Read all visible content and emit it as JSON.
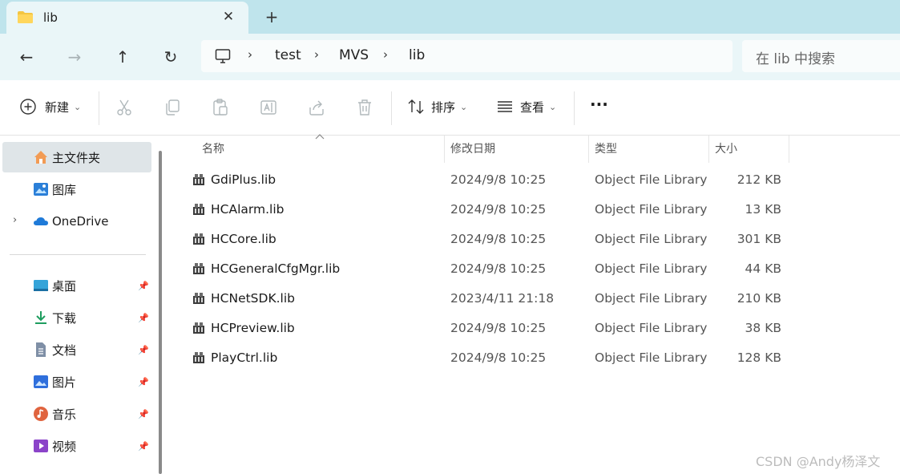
{
  "window": {
    "tab_title": "lib",
    "tab_close": "✕",
    "new_tab": "+"
  },
  "nav": {
    "back": "←",
    "forward": "→",
    "up": "↑",
    "refresh": "↻"
  },
  "breadcrumb": {
    "items": [
      "test",
      "MVS",
      "lib"
    ],
    "separator": "›"
  },
  "search": {
    "placeholder": "在 lib 中搜索"
  },
  "toolbar": {
    "new_label": "新建",
    "sort_label": "排序",
    "view_label": "查看",
    "more_label": "···",
    "dropdown_caret": "⌄"
  },
  "sidebar": {
    "items": [
      {
        "label": "主文件夹",
        "icon": "home-icon"
      },
      {
        "label": "图库",
        "icon": "gallery-icon"
      },
      {
        "label": "OneDrive",
        "icon": "cloud-icon",
        "expandable": true
      },
      {
        "label": "桌面",
        "icon": "desktop-icon",
        "pinned": true
      },
      {
        "label": "下载",
        "icon": "download-icon",
        "pinned": true
      },
      {
        "label": "文档",
        "icon": "document-icon",
        "pinned": true
      },
      {
        "label": "图片",
        "icon": "pictures-icon",
        "pinned": true
      },
      {
        "label": "音乐",
        "icon": "music-icon",
        "pinned": true
      },
      {
        "label": "视频",
        "icon": "video-icon",
        "pinned": true
      }
    ],
    "pin_glyph": "📌",
    "expand_glyph": "›"
  },
  "columns": {
    "name": "名称",
    "modified": "修改日期",
    "type": "类型",
    "size": "大小"
  },
  "files": [
    {
      "name": "GdiPlus.lib",
      "modified": "2024/9/8 10:25",
      "type": "Object File Library",
      "size": "212 KB"
    },
    {
      "name": "HCAlarm.lib",
      "modified": "2024/9/8 10:25",
      "type": "Object File Library",
      "size": "13 KB"
    },
    {
      "name": "HCCore.lib",
      "modified": "2024/9/8 10:25",
      "type": "Object File Library",
      "size": "301 KB"
    },
    {
      "name": "HCGeneralCfgMgr.lib",
      "modified": "2024/9/8 10:25",
      "type": "Object File Library",
      "size": "44 KB"
    },
    {
      "name": "HCNetSDK.lib",
      "modified": "2023/4/11 21:18",
      "type": "Object File Library",
      "size": "210 KB"
    },
    {
      "name": "HCPreview.lib",
      "modified": "2024/9/8 10:25",
      "type": "Object File Library",
      "size": "38 KB"
    },
    {
      "name": "PlayCtrl.lib",
      "modified": "2024/9/8 10:25",
      "type": "Object File Library",
      "size": "128 KB"
    }
  ],
  "watermark": "CSDN @Andy杨泽文",
  "colors": {
    "titlebar": "#bfe4ec",
    "navbar": "#eaf6f8",
    "selected": "#dfe5e8",
    "accent": "#0067c0"
  }
}
